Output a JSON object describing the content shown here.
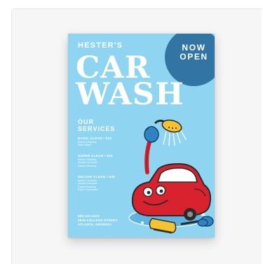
{
  "poster": {
    "brand": "HESTER'S",
    "badge": {
      "line1": "NOW",
      "line2": "OPEN"
    },
    "title_line1": "CAR",
    "title_line2": "WASH",
    "services_line1": "OUR",
    "services_line2": "SERVICES",
    "packages": [
      {
        "name": "BASIC CLEAN • $15",
        "details": [
          "Interior Cleaning",
          "Basic Wash"
        ]
      },
      {
        "name": "SUPER CLEAN • $20",
        "details": [
          "Interior Cleaning",
          "Scratch Removal",
          "Carpet Cleaning"
        ]
      },
      {
        "name": "DELUXE CLEAN • $30",
        "details": [
          "Interior Cleaning",
          "Scratch Removal",
          "Carpet Cleaning",
          "Panel Restoration"
        ]
      }
    ],
    "contact": {
      "phone": "800-123-4219",
      "street": "3948 COLLEGE STREET",
      "city": "ATLANTA, GEORGIA"
    },
    "colors": {
      "background": "#8fd4f1",
      "badge": "#3274a4",
      "car": "#d8232f",
      "glove": "#2f83c4",
      "brush": "#f4c430"
    }
  }
}
